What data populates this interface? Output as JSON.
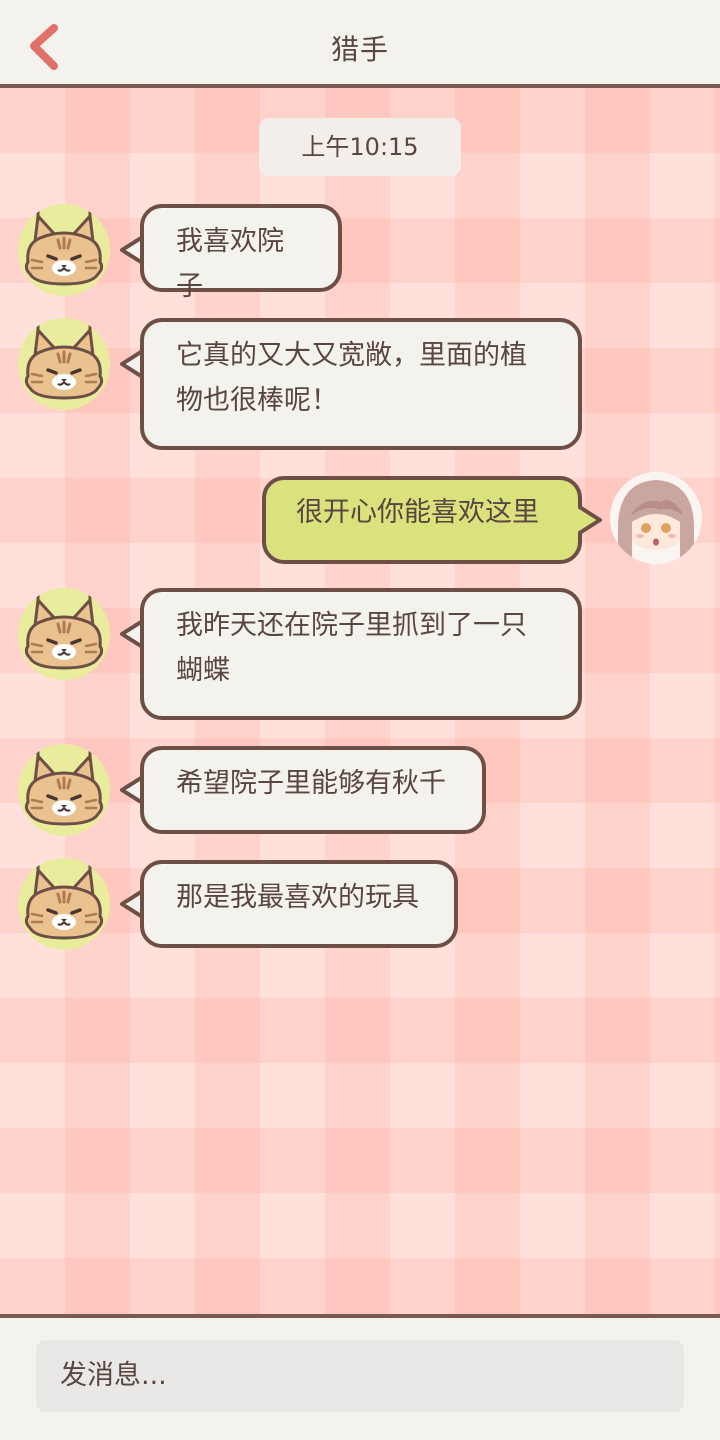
{
  "header": {
    "title": "猎手",
    "back_icon": "chevron-left-icon",
    "back_color": "#e0706a"
  },
  "chat": {
    "timestamp": "上午10:15",
    "messages": [
      {
        "sender": "other",
        "text": "我喜欢院子"
      },
      {
        "sender": "other",
        "line1": "它真的又大又宽敞，里面的植",
        "line2": "物也很棒呢！"
      },
      {
        "sender": "self",
        "text": "很开心你能喜欢这里"
      },
      {
        "sender": "other",
        "line1": "我昨天还在院子里抓到了一只",
        "line2": "蝴蝶"
      },
      {
        "sender": "other",
        "text": "希望院子里能够有秋千"
      },
      {
        "sender": "other",
        "text": "那是我最喜欢的玩具"
      }
    ]
  },
  "input": {
    "placeholder": "发消息..."
  },
  "colors": {
    "bubble_other": "#f4f2ec",
    "bubble_self": "#d9e27c",
    "bubble_border": "#6e4f45",
    "background_check": "#ffe0da",
    "avatar_bg": "#e8ec9c"
  }
}
